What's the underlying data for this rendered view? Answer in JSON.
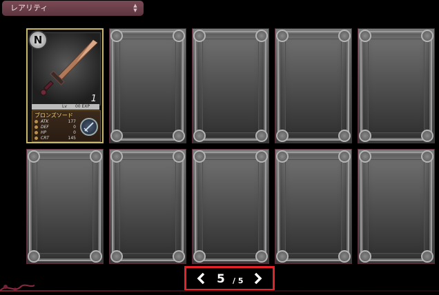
{
  "filter": {
    "rarity_label": "レアリティ"
  },
  "card": {
    "rank": "N",
    "name": "ブロンズソード",
    "level": "1",
    "lv_label": "Lv",
    "exp_text": "00 EXP",
    "stats": [
      {
        "key": "ATK",
        "value": "177"
      },
      {
        "key": "DEF",
        "value": "0"
      },
      {
        "key": "HP",
        "value": "0"
      },
      {
        "key": "CRT",
        "value": "145"
      }
    ]
  },
  "pager": {
    "current": "5",
    "total": "/ 5"
  },
  "colors": {
    "accent_border": "#e3222a",
    "card_gold": "#c9b86a",
    "dropdown_bg": "#6a3f4a"
  }
}
